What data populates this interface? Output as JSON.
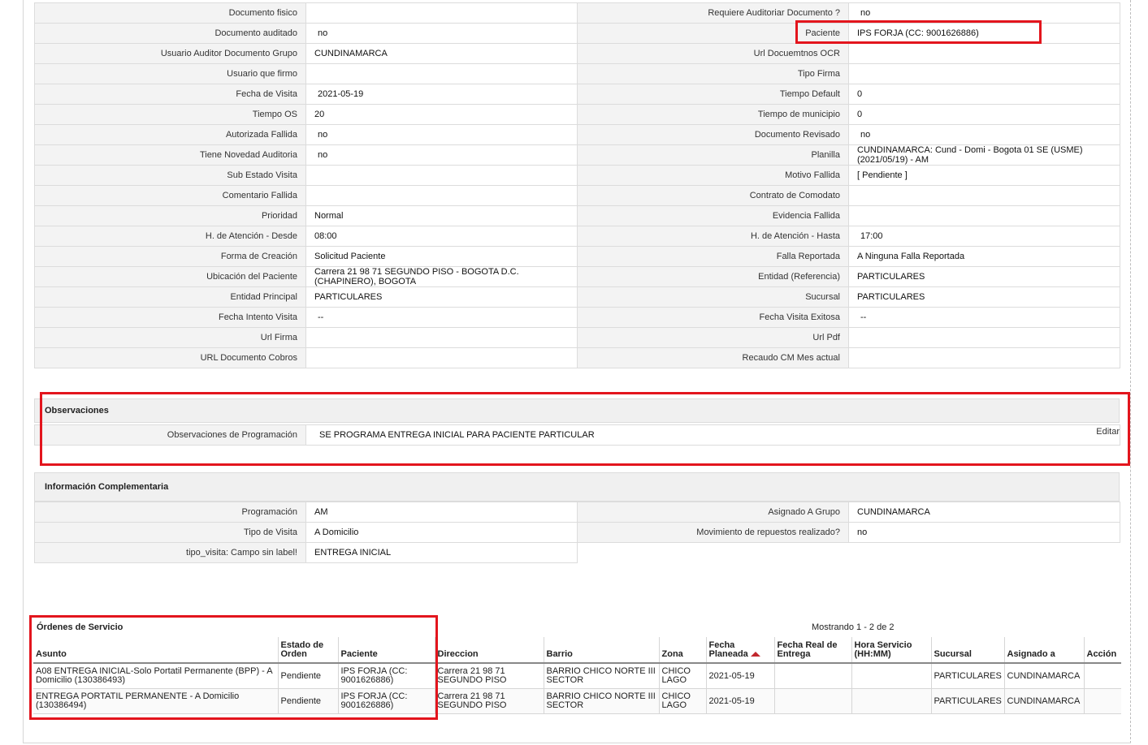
{
  "detail": {
    "rows": [
      {
        "l1": "Documento fisico",
        "v1": "",
        "l2": "Requiere Auditoriar Documento ?",
        "v2": "no"
      },
      {
        "l1": "Documento auditado",
        "v1": "no",
        "l2": "Paciente",
        "v2": "IPS FORJA (CC: 9001626886)"
      },
      {
        "l1": "Usuario Auditor Documento Grupo",
        "v1": "CUNDINAMARCA",
        "l2": "Url Docuemtnos OCR",
        "v2": ""
      },
      {
        "l1": "Usuario que firmo",
        "v1": "",
        "l2": "Tipo Firma",
        "v2": ""
      },
      {
        "l1": "Fecha de Visita",
        "v1": "2021-05-19",
        "l2": "Tiempo Default",
        "v2": "0"
      },
      {
        "l1": "Tiempo OS",
        "v1": "20",
        "l2": "Tiempo de municipio",
        "v2": "0"
      },
      {
        "l1": "Autorizada Fallida",
        "v1": "no",
        "l2": "Documento Revisado",
        "v2": "no"
      },
      {
        "l1": "Tiene Novedad Auditoria",
        "v1": "no",
        "l2": "Planilla",
        "v2": "CUNDINAMARCA: Cund - Domi - Bogota 01 SE (USME) (2021/05/19) - AM"
      },
      {
        "l1": "Sub Estado Visita",
        "v1": "",
        "l2": "Motivo Fallida",
        "v2": "[ Pendiente ]"
      },
      {
        "l1": "Comentario Fallida",
        "v1": "",
        "l2": "Contrato de Comodato",
        "v2": ""
      },
      {
        "l1": "Prioridad",
        "v1": "Normal",
        "l2": "Evidencia Fallida",
        "v2": ""
      },
      {
        "l1": "H. de Atención - Desde",
        "v1": "08:00",
        "l2": "H. de Atención - Hasta",
        "v2": "17:00"
      },
      {
        "l1": "Forma de Creación",
        "v1": "Solicitud Paciente",
        "l2": "Falla Reportada",
        "v2": "A Ninguna Falla Reportada"
      },
      {
        "l1": "Ubicación del Paciente",
        "v1": "Carrera 21 98 71 SEGUNDO PISO - BOGOTA D.C. (CHAPINERO), BOGOTA",
        "l2": "Entidad (Referencia)",
        "v2": "PARTICULARES"
      },
      {
        "l1": "Entidad Principal",
        "v1": "PARTICULARES",
        "l2": "Sucursal",
        "v2": "PARTICULARES"
      },
      {
        "l1": "Fecha Intento Visita",
        "v1": "--",
        "l2": "Fecha Visita Exitosa",
        "v2": "--"
      },
      {
        "l1": "Url Firma",
        "v1": "",
        "l2": "Url Pdf",
        "v2": ""
      },
      {
        "l1": "URL Documento Cobros",
        "v1": "",
        "l2": "Recaudo CM Mes actual",
        "v2": ""
      }
    ]
  },
  "observaciones": {
    "title": "Observaciones",
    "label": "Observaciones de Programación",
    "value": "SE PROGRAMA ENTREGA INICIAL PARA PACIENTE PARTICULAR",
    "edit": "Editar"
  },
  "complementaria": {
    "title": "Información Complementaria",
    "rows": [
      {
        "l1": "Programación",
        "v1": "AM",
        "l2": "Asignado A Grupo",
        "v2": "CUNDINAMARCA"
      },
      {
        "l1": "Tipo de Visita",
        "v1": "A Domicilio",
        "l2": "Movimiento de repuestos realizado?",
        "v2": "no"
      },
      {
        "l1": "tipo_visita: Campo sin label!",
        "v1": "ENTREGA INICIAL"
      }
    ]
  },
  "ordenes": {
    "title": "Órdenes de Servicio",
    "showing": "Mostrando 1 - 2 de 2",
    "headers": [
      "Asunto",
      "Estado de Orden",
      "Paciente",
      "Direccion",
      "Barrio",
      "Zona",
      "Fecha Planeada",
      "Fecha Real de Entrega",
      "Hora Servicio (HH:MM)",
      "Sucursal",
      "Asignado a",
      "Acción"
    ],
    "rows": [
      {
        "asunto": "A08 ENTREGA INICIAL-Solo Portatil Permanente (BPP) - A Domicilio (130386493)",
        "estado": "Pendiente",
        "paciente": "IPS FORJA (CC: 9001626886)",
        "direccion": "Carrera 21 98 71 SEGUNDO PISO",
        "barrio": "BARRIO CHICO NORTE III SECTOR",
        "zona": "CHICO LAGO",
        "fecha_planeada": "2021-05-19",
        "fecha_real": "",
        "hora": "",
        "sucursal": "PARTICULARES",
        "asignado": "CUNDINAMARCA",
        "accion": ""
      },
      {
        "asunto": "ENTREGA PORTATIL PERMANENTE - A Domicilio (130386494)",
        "estado": "Pendiente",
        "paciente": "IPS FORJA (CC: 9001626886)",
        "direccion": "Carrera 21 98 71 SEGUNDO PISO",
        "barrio": "BARRIO CHICO NORTE III SECTOR",
        "zona": "CHICO LAGO",
        "fecha_planeada": "2021-05-19",
        "fecha_real": "",
        "hora": "",
        "sucursal": "PARTICULARES",
        "asignado": "CUNDINAMARCA",
        "accion": ""
      }
    ]
  }
}
